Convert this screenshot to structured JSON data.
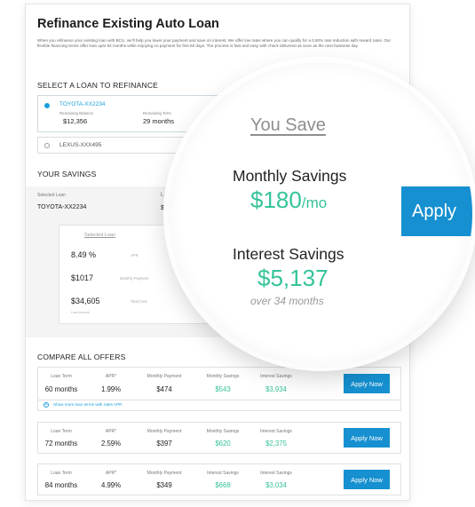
{
  "page": {
    "title": "Refinance Existing Auto Loan",
    "intro": "When you refinance your existing loan with BCU, we'll help you lower your payment and save on interest. We offer low rates where you can qualify for a 0.50% rate reduction with reward rates. Our flexible financing terms offer loan upto 84 months while enjoying no payment for first 60 days. The process is fast and easy with check delivered as soon as the next business day."
  },
  "select_loan": {
    "heading": "SELECT A LOAN TO REFINANCE",
    "selected": {
      "name": "TOYOTA-XX2234",
      "remaining_balance_label": "Remaining Balance",
      "remaining_balance": "$12,356",
      "remaining_term_label": "Remaining Term",
      "remaining_term": "29 months"
    },
    "other": {
      "name": "LEXUS-XXX495"
    }
  },
  "savings": {
    "heading": "YOUR SAVINGS",
    "selected_loan_label": "Selected Loan",
    "selected_loan": "TOYOTA-XX2234",
    "partial_label": "L",
    "partial_value": "$",
    "card": {
      "header": "Selected Loan",
      "apr": "8.49 %",
      "apr_label": "APR",
      "monthly": "$1017",
      "monthly_label": "Monthly Payment",
      "total": "$34,605",
      "total_label": "Total Cost",
      "total_sub": "Loan Amount",
      "partial_value": "$"
    }
  },
  "lens": {
    "title": "You Save",
    "monthly_label": "Monthly Savings",
    "monthly_value": "$180",
    "monthly_unit": "/mo",
    "interest_label": "Interest Savings",
    "interest_value": "$5,137",
    "interest_sub": "over 34 months",
    "apply_label": "Apply"
  },
  "compare": {
    "heading": "COMPARE ALL OFFERS",
    "more_link": "Show more loan terms with rates APR",
    "columns": [
      "Loan Term",
      "APR*",
      "Monthly Payment",
      "Monthly Savings",
      "Interest Savings"
    ],
    "offers": [
      {
        "term": "60 months",
        "apr": "1.99%",
        "payment": "$474",
        "monthly_savings": "$543",
        "interest_savings": "$3,934",
        "savings_col_label": "Monthly Savings",
        "button": "Apply Now"
      },
      {
        "term": "72 months",
        "apr": "2.59%",
        "payment": "$397",
        "monthly_savings": "$620",
        "interest_savings": "$2,375",
        "savings_col_label": "Monthly Savings",
        "button": "Apply Now"
      },
      {
        "term": "84 months",
        "apr": "4.99%",
        "payment": "$349",
        "monthly_savings": "$668",
        "interest_savings": "$3,034",
        "savings_col_label": "Interest Savings",
        "button": "Apply Now"
      }
    ]
  },
  "colors": {
    "accent": "#1a9fd8",
    "button": "#1690d0",
    "savings_green": "#35c39a"
  }
}
